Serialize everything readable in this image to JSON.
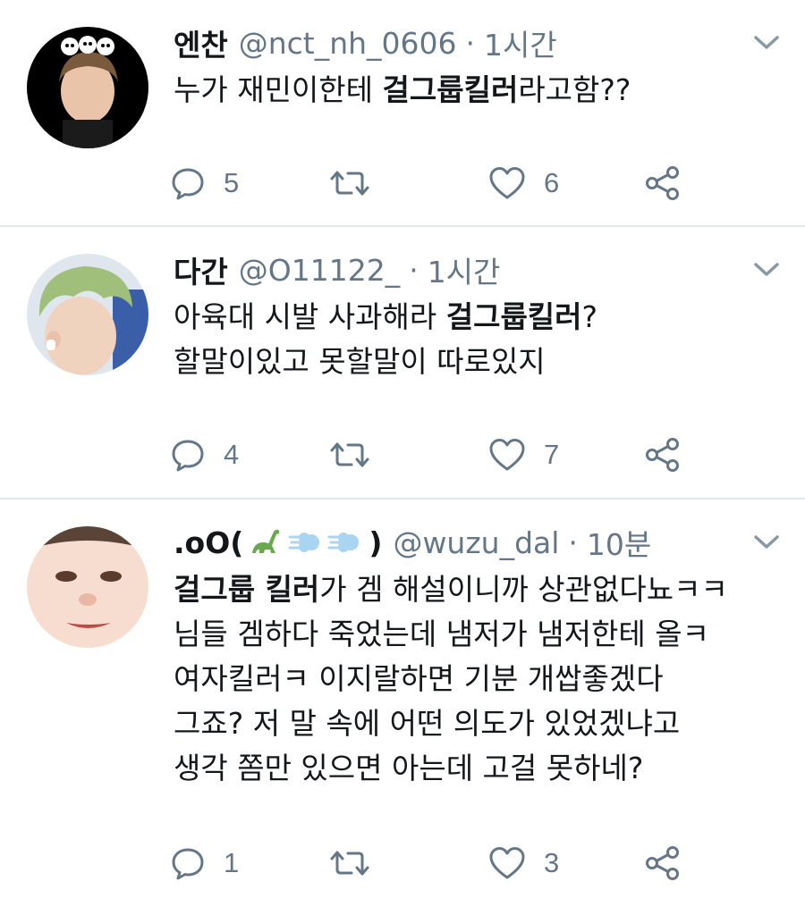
{
  "tweets": [
    {
      "name": "엔찬",
      "handle": "@nct_nh_0606",
      "sep": "·",
      "time": "1시간",
      "lines": [
        {
          "parts": [
            {
              "t": "누가 재민이한테 ",
              "b": false
            },
            {
              "t": "걸그룹킬러",
              "b": true
            },
            {
              "t": "라고함??",
              "b": false
            }
          ]
        }
      ],
      "replies": "5",
      "likes": "6",
      "avatar_label": "We Boom"
    },
    {
      "name": "다간",
      "handle": "@O11122_",
      "sep": "·",
      "time": "1시간",
      "lines": [
        {
          "parts": [
            {
              "t": "아육대 시발 사과해라 ",
              "b": false
            },
            {
              "t": "걸그룹킬러",
              "b": true
            },
            {
              "t": "?",
              "b": false
            }
          ]
        },
        {
          "parts": [
            {
              "t": "할말이있고 못할말이 따로있지",
              "b": false
            }
          ]
        }
      ],
      "replies": "4",
      "likes": "7"
    },
    {
      "name_prefix": ".oO(",
      "name_suffix": ")",
      "handle": "@wuzu_dal",
      "sep": "·",
      "time": "10분",
      "lines": [
        {
          "parts": [
            {
              "t": "걸그룹 킬러",
              "b": true
            },
            {
              "t": "가 겜 해설이니까 상관없다뇨ㅋㅋ",
              "b": false
            }
          ]
        },
        {
          "parts": [
            {
              "t": "님들 겜하다 죽었는데 냄저가 냄저한테 올ㅋ",
              "b": false
            }
          ]
        },
        {
          "parts": [
            {
              "t": "여자킬러ㅋ 이지랄하면 기분 개쌉좋겠다",
              "b": false
            }
          ]
        },
        {
          "parts": [
            {
              "t": "그죠? 저 말 속에 어떤 의도가 있었겠냐고",
              "b": false
            }
          ]
        },
        {
          "parts": [
            {
              "t": "생각 쫌만 있으면 아는데 고걸 못하네?",
              "b": false
            }
          ]
        }
      ],
      "replies": "1",
      "likes": "3"
    }
  ],
  "icons": {
    "reply": "reply-icon",
    "retweet": "retweet-icon",
    "like": "heart-icon",
    "share": "share-icon",
    "caret": "chevron-down-icon"
  },
  "colors": {
    "icon": "#657786",
    "text": "#14171a",
    "divider": "#e1e8ed"
  }
}
